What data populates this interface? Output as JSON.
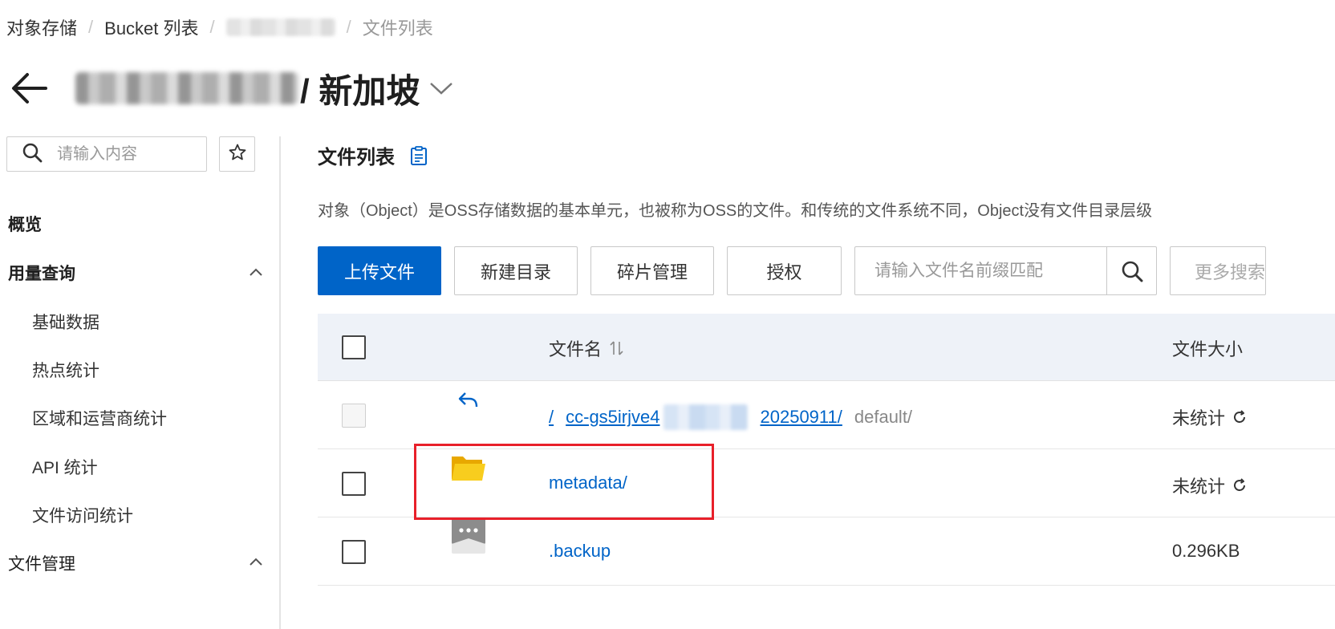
{
  "breadcrumb": {
    "items": [
      "对象存储",
      "Bucket 列表",
      "文件列表"
    ],
    "separator": "/"
  },
  "header": {
    "title": "/ 新加坡"
  },
  "sidebar": {
    "search_placeholder": "请输入内容",
    "items": [
      {
        "label": "概览",
        "level": "top"
      },
      {
        "label": "用量查询",
        "level": "top",
        "expanded": true
      },
      {
        "label": "基础数据",
        "level": "sub"
      },
      {
        "label": "热点统计",
        "level": "sub"
      },
      {
        "label": "区域和运营商统计",
        "level": "sub"
      },
      {
        "label": "API 统计",
        "level": "sub"
      },
      {
        "label": "文件访问统计",
        "level": "sub"
      },
      {
        "label": "文件管理",
        "level": "top",
        "expanded": true
      }
    ]
  },
  "main": {
    "section_title": "文件列表",
    "description": "对象（Object）是OSS存储数据的基本单元，也被称为OSS的文件。和传统的文件系统不同，Object没有文件目录层级",
    "toolbar": {
      "upload": "上传文件",
      "new_dir": "新建目录",
      "fragments": "碎片管理",
      "authorize": "授权",
      "search_placeholder": "请输入文件名前缀匹配",
      "more_search": "更多搜索"
    },
    "table": {
      "col_name": "文件名",
      "col_size": "文件大小",
      "path_row": {
        "root": "/",
        "prefix": "cc-gs5irjve4",
        "suffix": "20250911/",
        "tail": "default/",
        "size": "未统计"
      },
      "rows": [
        {
          "name": "metadata/",
          "size": "未统计",
          "type": "folder"
        },
        {
          "name": ".backup",
          "size": "0.296KB",
          "type": "file"
        }
      ]
    }
  },
  "colors": {
    "primary": "#0064c8",
    "highlight": "#e8202a",
    "folder": "#f5c518",
    "table_header_bg": "#eef2f8"
  }
}
